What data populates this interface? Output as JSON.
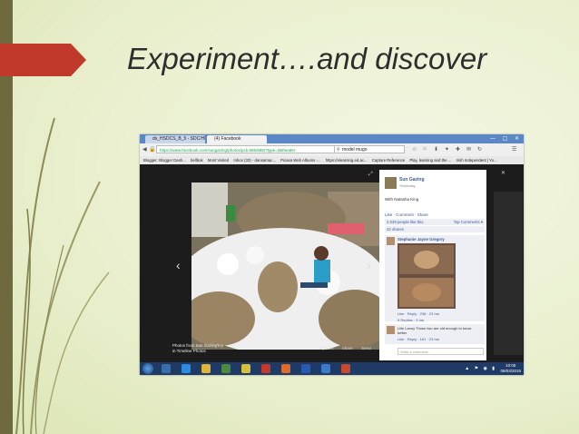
{
  "slide": {
    "title": "Experiment….and discover",
    "colors": {
      "arrow": "#c0392b",
      "left_strip": "#6f6a3e",
      "background": "#eaf0cf"
    }
  },
  "browser": {
    "tabs": [
      "ds_HSDCS_B_5 - SDC/HEB...",
      "(4) Facebook"
    ],
    "url": "https://www.facebook.com/sungazing/photos/pcb.685/685/?type=3&theater",
    "search_value": "model mugo",
    "bookmarks": [
      "Blogger: Blogger Dash...",
      "bellbok",
      "Most Visited",
      "Inbox (33) - dansamac...",
      "Picasa Web Albums -...",
      "https://elearning.ed.ac...",
      "Capture Reference",
      "Play, learning and the ...",
      "Irish Independent | Yo..."
    ]
  },
  "photo_viewer": {
    "caption_line1": "Photos from Sun Gazing's p",
    "caption_line2": "in Timeline Photos",
    "options": [
      "Options",
      "Share",
      "Send",
      "Like"
    ]
  },
  "facebook_panel": {
    "page_name": "Sun Gazing",
    "date": "Yesterday",
    "with_text": "With Natasha King",
    "actions": "Like · Comment · Share",
    "likes_text": "2,029 people like this.",
    "top_comments": "Top Comments ▾",
    "shares_text": "42 shares",
    "comment1_name": "Stephanie Jayne Gregory",
    "comment1_actions": "Like · Reply · 238 · 23 hrs",
    "comment1_replies": "9 Replies · 3 hrs",
    "comment2_text": "Lille Lanny Those two are old enough to know better",
    "comment2_actions": "Like · Reply · 161 · 23 hrs",
    "write_placeholder": "Write a comment..."
  },
  "taskbar": {
    "time": "10:05",
    "date": "08/03/2015"
  },
  "icons": [
    "windows-start-icon",
    "ie-icon",
    "folder-icon",
    "chrome-icon",
    "firefox-icon",
    "outlook-icon",
    "powerpoint-icon"
  ]
}
